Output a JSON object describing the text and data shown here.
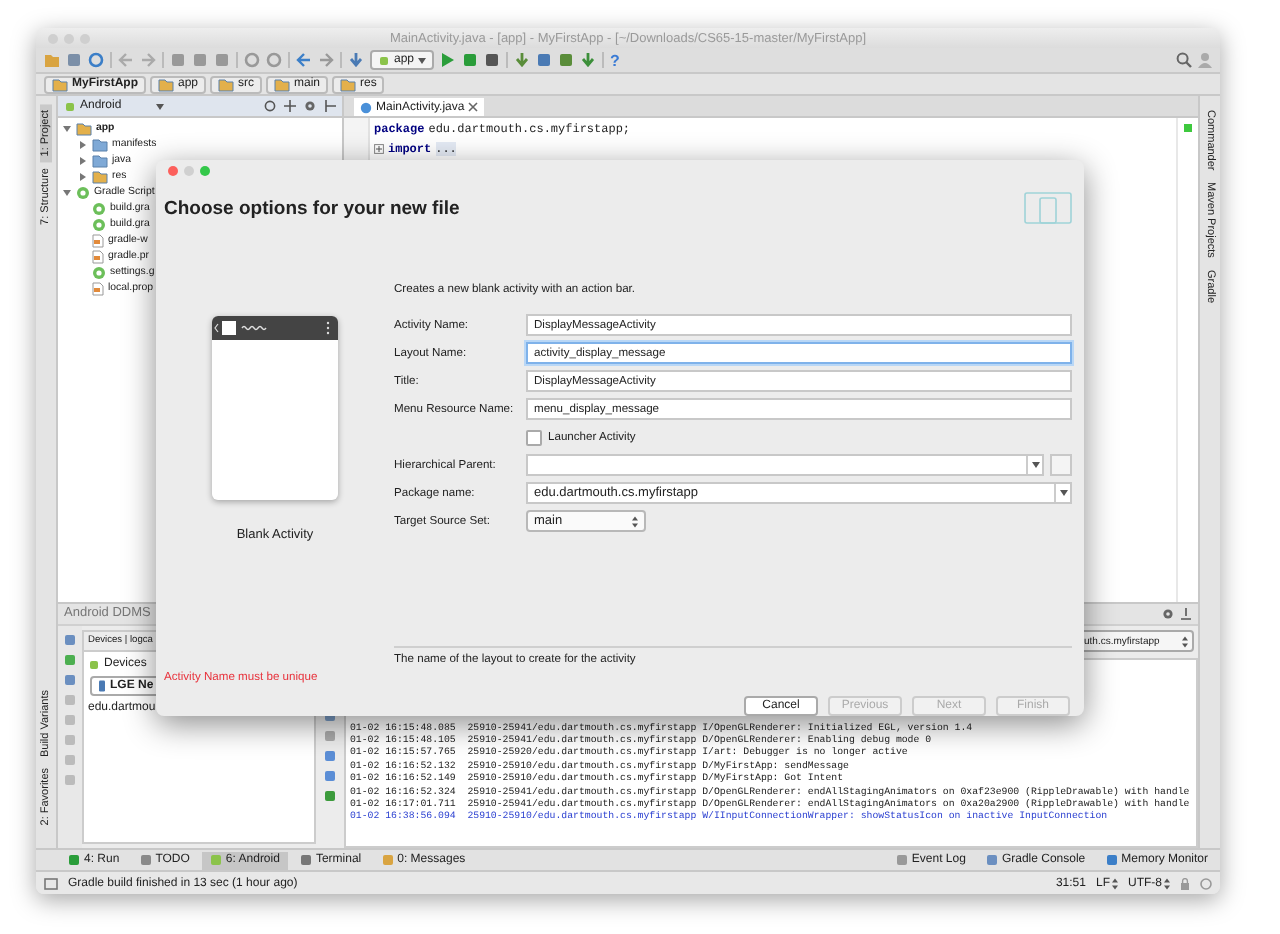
{
  "window": {
    "title": "MainActivity.java - [app] - MyFirstApp - [~/Downloads/CS65-15-master/MyFirstApp]"
  },
  "toolbar": {
    "run_config": "app",
    "help": "?"
  },
  "breadcrumbs": [
    "MyFirstApp",
    "app",
    "src",
    "main",
    "res"
  ],
  "left_strip": {
    "top": [
      {
        "label": "1: Project",
        "selected": true
      },
      {
        "label": "7: Structure",
        "selected": false
      }
    ],
    "bottom": [
      {
        "label": "Build Variants",
        "selected": false
      },
      {
        "label": "2: Favorites",
        "selected": false
      }
    ]
  },
  "project_panel": {
    "view": "Android",
    "tree": [
      {
        "label": "app",
        "kind": "module",
        "expanded": true,
        "children": [
          {
            "label": "manifests",
            "kind": "folder",
            "expanded": false
          },
          {
            "label": "java",
            "kind": "folder",
            "expanded": false
          },
          {
            "label": "res",
            "kind": "resfolder",
            "expanded": false
          }
        ]
      },
      {
        "label": "Gradle Script",
        "kind": "gradle",
        "expanded": true,
        "children": [
          {
            "label": "build.gra",
            "kind": "gradle"
          },
          {
            "label": "build.gra",
            "kind": "gradle"
          },
          {
            "label": "gradle-w",
            "kind": "file"
          },
          {
            "label": "gradle.pr",
            "kind": "file"
          },
          {
            "label": "settings.g",
            "kind": "gradle"
          },
          {
            "label": "local.prop",
            "kind": "file"
          }
        ]
      }
    ]
  },
  "editor": {
    "tabs": [
      {
        "label": "MainActivity.java",
        "selected": true
      }
    ],
    "lines": [
      {
        "keyword": "package",
        "text": "edu.dartmouth.cs.myfirstapp;",
        "folded": false
      },
      {
        "keyword": "import",
        "text": "...",
        "folded": true
      }
    ]
  },
  "right_strip": [
    "Commander",
    "Maven Projects",
    "Gradle"
  ],
  "ddms": {
    "title": "Android DDMS",
    "tabs": "Devices | logca",
    "devices_label": "Devices",
    "device": "LGE Ne",
    "process": "edu.dartmou"
  },
  "logcat": {
    "process_filter": "uth.cs.myfirstapp",
    "lines": [
      {
        "kind": "info",
        "text": "01-02 16:15:48.085  25910-25941/edu.dartmouth.cs.myfirstapp I/OpenGLRenderer: Initialized EGL, version 1.4"
      },
      {
        "kind": "info",
        "text": "01-02 16:15:48.105  25910-25941/edu.dartmouth.cs.myfirstapp D/OpenGLRenderer: Enabling debug mode 0"
      },
      {
        "kind": "info",
        "text": "01-02 16:15:57.765  25910-25920/edu.dartmouth.cs.myfirstapp I/art: Debugger is no longer active"
      },
      {
        "kind": "info",
        "text": "01-02 16:16:52.132  25910-25910/edu.dartmouth.cs.myfirstapp D/MyFirstApp: sendMessage"
      },
      {
        "kind": "info",
        "text": "01-02 16:16:52.149  25910-25910/edu.dartmouth.cs.myfirstapp D/MyFirstApp: Got Intent"
      },
      {
        "kind": "info",
        "text": "01-02 16:16:52.324  25910-25941/edu.dartmouth.cs.myfirstapp D/OpenGLRenderer: endAllStagingAnimators on 0xaf23e900 (RippleDrawable) with handle"
      },
      {
        "kind": "info",
        "text": "01-02 16:17:01.711  25910-25941/edu.dartmouth.cs.myfirstapp D/OpenGLRenderer: endAllStagingAnimators on 0xa20a2900 (RippleDrawable) with handle"
      },
      {
        "kind": "warning",
        "text": "01-02 16:38:56.094  25910-25910/edu.dartmouth.cs.myfirstapp W/IInputConnectionWrapper: showStatusIcon on inactive InputConnection"
      }
    ]
  },
  "tool_windows": {
    "left": [
      {
        "label": "4: Run",
        "selected": false
      },
      {
        "label": "TODO",
        "selected": false
      },
      {
        "label": "6: Android",
        "selected": true
      },
      {
        "label": "Terminal",
        "selected": false
      },
      {
        "label": "0: Messages",
        "selected": false
      }
    ],
    "right": [
      "Event Log",
      "Gradle Console",
      "Memory Monitor"
    ]
  },
  "status_bar": {
    "message": "Gradle build finished in 13 sec (1 hour ago)",
    "position": "31:51",
    "line_separator": "LF",
    "encoding": "UTF-8"
  },
  "dialog": {
    "title": "Choose options for your new file",
    "template": "Blank Activity",
    "description": "Creates a new blank activity with an action bar.",
    "fields": [
      {
        "kind": "text",
        "label": "Activity Name:",
        "value": "DisplayMessageActivity",
        "focused": false
      },
      {
        "kind": "text",
        "label": "Layout Name:",
        "value": "activity_display_message",
        "focused": true
      },
      {
        "kind": "text",
        "label": "Title:",
        "value": "DisplayMessageActivity",
        "focused": false
      },
      {
        "kind": "text",
        "label": "Menu Resource Name:",
        "value": "menu_display_message",
        "focused": false
      },
      {
        "kind": "checkbox",
        "label": "Launcher Activity",
        "checked": false
      },
      {
        "kind": "combo_browse",
        "label": "Hierarchical Parent:"
      },
      {
        "kind": "combo",
        "label": "Package name:",
        "value": "edu.dartmouth.cs.myfirstapp"
      },
      {
        "kind": "select",
        "label": "Target Source Set:",
        "value": "main"
      }
    ],
    "hint": "The name of the layout to create for the activity",
    "error": "Activity Name must be unique",
    "buttons": [
      {
        "label": "Cancel",
        "disabled": false
      },
      {
        "label": "Previous",
        "disabled": true
      },
      {
        "label": "Next",
        "disabled": true
      },
      {
        "label": "Finish",
        "disabled": true
      }
    ]
  }
}
